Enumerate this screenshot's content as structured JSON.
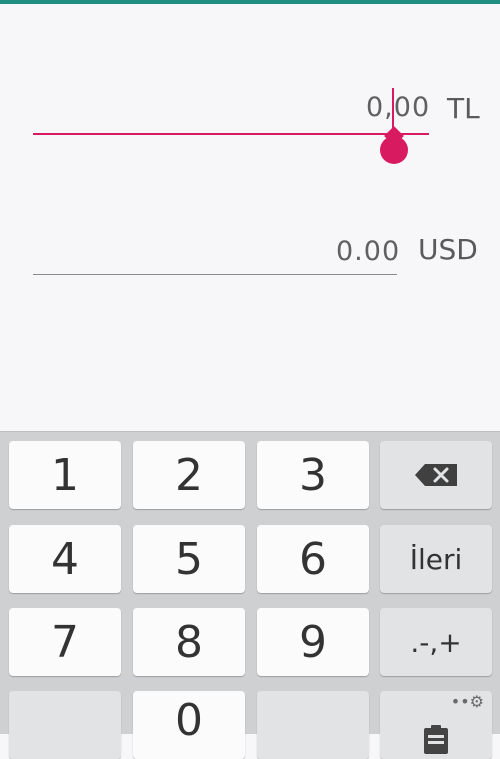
{
  "fields": {
    "tl": {
      "value": "0,00",
      "currency": "TL"
    },
    "usd": {
      "value": "0.00",
      "currency": "USD"
    }
  },
  "keyboard": {
    "row1": [
      "1",
      "2",
      "3"
    ],
    "row2": [
      "4",
      "5",
      "6"
    ],
    "next_label": "İleri",
    "row3": [
      "7",
      "8",
      "9"
    ],
    "symbols_label": ".-,+",
    "row4_zero": "0",
    "settings_dots": "••⚙"
  },
  "colors": {
    "accent": "#d81b60",
    "status_bar": "#1e8f82",
    "keyboard_bg": "#cfd0d2"
  }
}
